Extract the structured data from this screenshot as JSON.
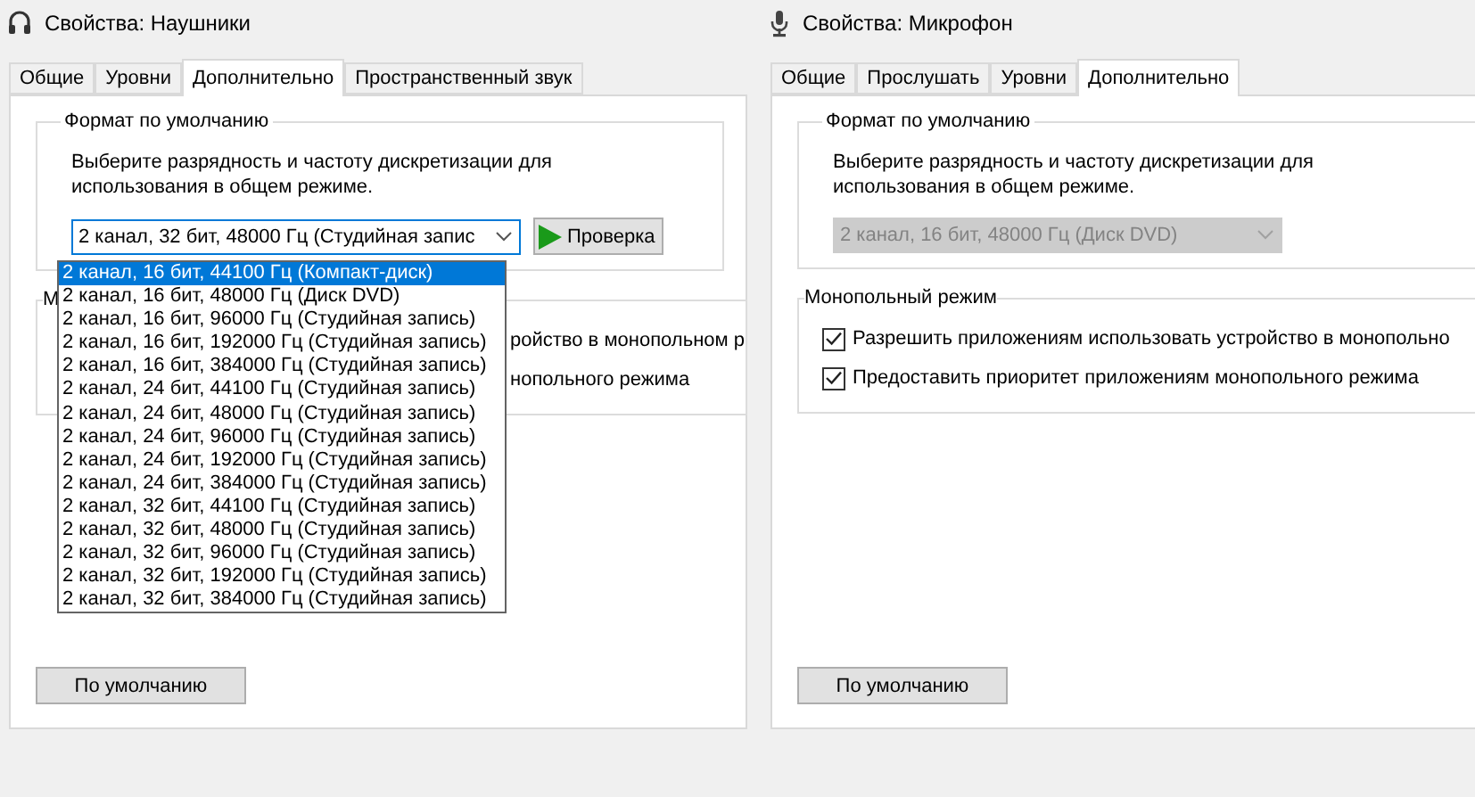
{
  "dialogs": [
    {
      "title": "Свойства: Наушники",
      "tabs": [
        {
          "label": "Общие",
          "selected": false
        },
        {
          "label": "Уровни",
          "selected": false
        },
        {
          "label": "Дополнительно",
          "selected": true
        },
        {
          "label": "Пространственный звук",
          "selected": false
        }
      ],
      "format_group": {
        "label": "Формат по умолчанию",
        "description": "Выберите разрядность и частоту дискретизации для\nиспользования в общем режиме.",
        "select": {
          "value": "2 канал, 32 бит, 48000 Гц (Студийная запис",
          "disabled": false,
          "expanded": true
        },
        "test_button": "Проверка",
        "options": [
          {
            "label": "2 канал, 16 бит, 44100 Гц (Компакт-диск)",
            "selected": true
          },
          {
            "label": "2 канал, 16 бит, 48000 Гц (Диск DVD)",
            "selected": false
          },
          {
            "label": "2 канал, 16 бит, 96000 Гц (Студийная запись)",
            "selected": false
          },
          {
            "label": "2 канал, 16 бит, 192000 Гц (Студийная запись)",
            "selected": false
          },
          {
            "label": "2 канал, 16 бит, 384000 Гц (Студийная запись)",
            "selected": false
          },
          {
            "label": "2 канал, 24 бит, 44100 Гц (Студийная запись)",
            "selected": false
          },
          {
            "label": "2 канал, 24 бит, 48000 Гц (Студийная запись)",
            "selected": false
          },
          {
            "label": "2 канал, 24 бит, 96000 Гц (Студийная запись)",
            "selected": false
          },
          {
            "label": "2 канал, 24 бит, 192000 Гц (Студийная запись)",
            "selected": false
          },
          {
            "label": "2 канал, 24 бит, 384000 Гц (Студийная запись)",
            "selected": false
          },
          {
            "label": "2 канал, 32 бит, 44100 Гц (Студийная запись)",
            "selected": false
          },
          {
            "label": "2 канал, 32 бит, 48000 Гц (Студийная запись)",
            "selected": false
          },
          {
            "label": "2 канал, 32 бит, 96000 Гц (Студийная запись)",
            "selected": false
          },
          {
            "label": "2 канал, 32 бит, 192000 Гц (Студийная запись)",
            "selected": false
          },
          {
            "label": "2 канал, 32 бит, 384000 Гц (Студийная запись)",
            "selected": false
          }
        ]
      },
      "exclusive_group": {
        "label": "М",
        "options": [
          {
            "label": "ройство в монопольном р"
          },
          {
            "label": "нопольного режима"
          }
        ]
      },
      "default_button": "По умолчанию"
    },
    {
      "title": "Свойства: Микрофон",
      "tabs": [
        {
          "label": "Общие",
          "selected": false
        },
        {
          "label": "Прослушать",
          "selected": false
        },
        {
          "label": "Уровни",
          "selected": false
        },
        {
          "label": "Дополнительно",
          "selected": true
        }
      ],
      "format_group": {
        "label": "Формат по умолчанию",
        "description": "Выберите разрядность и частоту дискретизации для\nиспользования в общем режиме.",
        "select": {
          "value": "2 канал, 16 бит, 48000 Гц (Диск DVD)",
          "disabled": true,
          "expanded": false
        }
      },
      "exclusive_group": {
        "label": "Монопольный режим",
        "options": [
          {
            "label": "Разрешить приложениям использовать устройство в монопольно",
            "checked": true
          },
          {
            "label": "Предоставить приоритет приложениям монопольного режима",
            "checked": true
          }
        ]
      },
      "default_button": "По умолчанию"
    }
  ]
}
